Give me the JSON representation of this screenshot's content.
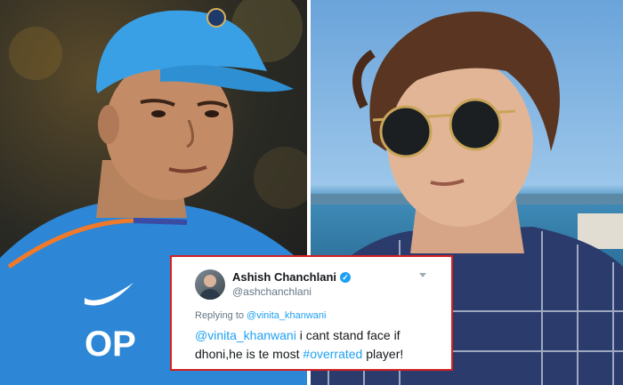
{
  "tweet": {
    "name": "Ashish Chanchlani",
    "verified_icon": "verified-badge-icon",
    "handle": "@ashchanchlani",
    "replying_to_label": "Replying to",
    "replying_to_handle": "@vinita_khanwani",
    "mention": "@vinita_khanwani",
    "text_part1": " i cant stand face if dhoni,he is te most ",
    "hashtag": "#overrated",
    "text_part2": " player!"
  },
  "jersey": {
    "text": "OP"
  },
  "colors": {
    "tweet_border": "#d62020",
    "link": "#1da1f2"
  }
}
